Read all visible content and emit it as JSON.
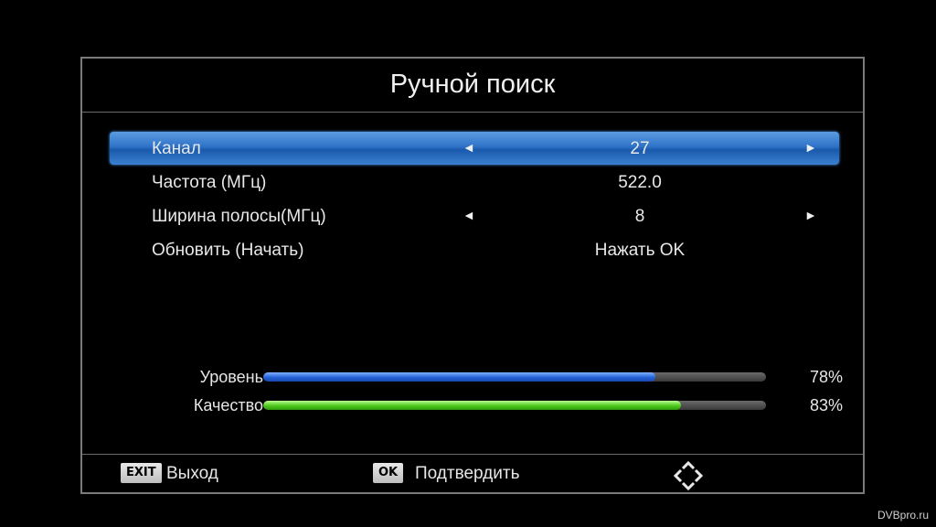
{
  "dialog": {
    "title": "Ручной поиск"
  },
  "menu": {
    "items": [
      {
        "label": "Канал",
        "value": "27",
        "selected": true,
        "has_arrows": true
      },
      {
        "label": "Частота (МГц)",
        "value": "522.0",
        "selected": false,
        "has_arrows": false
      },
      {
        "label": "Ширина полосы(МГц)",
        "value": "8",
        "selected": false,
        "has_arrows": true
      },
      {
        "label": "Обновить (Начать)",
        "value": "Нажать OK",
        "selected": false,
        "has_arrows": false
      }
    ],
    "arrow_left_glyph": "◄",
    "arrow_right_glyph": "►"
  },
  "signal": {
    "level": {
      "label": "Уровень",
      "percent_text": "78%",
      "fraction": 0.78,
      "color": "#2563d8"
    },
    "quality": {
      "label": "Качество",
      "percent_text": "83%",
      "fraction": 0.83,
      "color": "#4fc81e"
    }
  },
  "footer": {
    "exit_key": "EXIT",
    "exit_label": "Выход",
    "ok_key": "OK",
    "ok_label": "Подтвердить",
    "nav_icon": "dpad-arrows-icon"
  },
  "watermark": "DVBpro.ru",
  "colors": {
    "selection": "#2f73c8",
    "background": "#000000",
    "border": "#7a7a7a"
  }
}
